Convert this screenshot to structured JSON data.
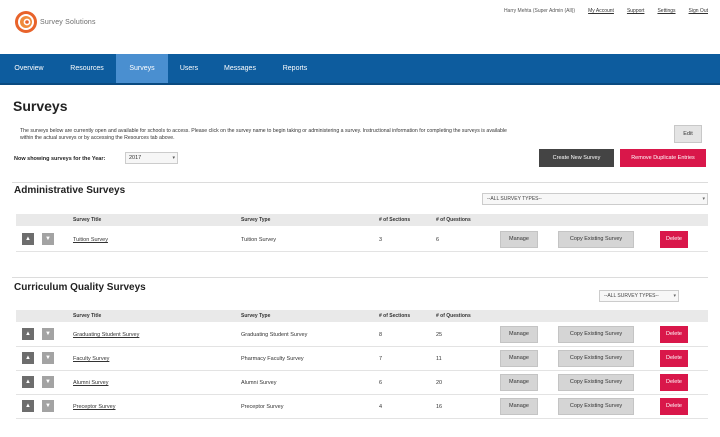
{
  "brand": {
    "name": "Survey Solutions",
    "logo_icon": "spiral-logo-icon",
    "accent": "#e8632b"
  },
  "user_nav": {
    "user": "Harry Mehta (Super Admin (All))",
    "my_account": "My Account",
    "support": "Support",
    "settings": "Settings",
    "sign_out": "Sign Out"
  },
  "nav": {
    "color": "#0d5c9e",
    "active": "Surveys",
    "items": [
      "Overview",
      "Resources",
      "Surveys",
      "Users",
      "Messages",
      "Reports"
    ]
  },
  "page": {
    "title": "Surveys",
    "intro_line1": "The surveys below are currently open and available for schools to access. Please click on the survey name to begin taking or administering a survey. Instructional information for completing the surveys is available",
    "intro_line2": "within the actual surveys or by accessing the Resources tab above.",
    "edit_label": "Edit",
    "year_label": "Now showing surveys for the Year:",
    "year_value": "2017",
    "create_label": "Create New Survey",
    "remove_label": "Remove Duplicate Entries"
  },
  "columns": {
    "title": "Survey Title",
    "type": "Survey Type",
    "sections": "# of Sections",
    "questions": "# of Questions"
  },
  "row_actions": {
    "manage": "Manage",
    "copy": "Copy Existing Survey",
    "delete": "Delete",
    "delete_color": "#d9174a"
  },
  "admin": {
    "heading": "Administrative Surveys",
    "filter": "--ALL SURVEY TYPES--",
    "rows": [
      {
        "title": "Tuition Survey",
        "type": "Tuition Survey",
        "sections": "3",
        "questions": "6"
      }
    ]
  },
  "curriculum": {
    "heading": "Curriculum Quality Surveys",
    "filter": "--ALL SURVEY TYPES--",
    "rows": [
      {
        "title": "Graduating Student Survey",
        "type": "Graduating Student Survey",
        "sections": "8",
        "questions": "25"
      },
      {
        "title": "Faculty Survey",
        "type": "Pharmacy Faculty Survey",
        "sections": "7",
        "questions": "11"
      },
      {
        "title": "Alumni Survey",
        "type": "Alumni Survey",
        "sections": "6",
        "questions": "20"
      },
      {
        "title": "Preceptor Survey",
        "type": "Preceptor Survey",
        "sections": "4",
        "questions": "16"
      }
    ]
  }
}
